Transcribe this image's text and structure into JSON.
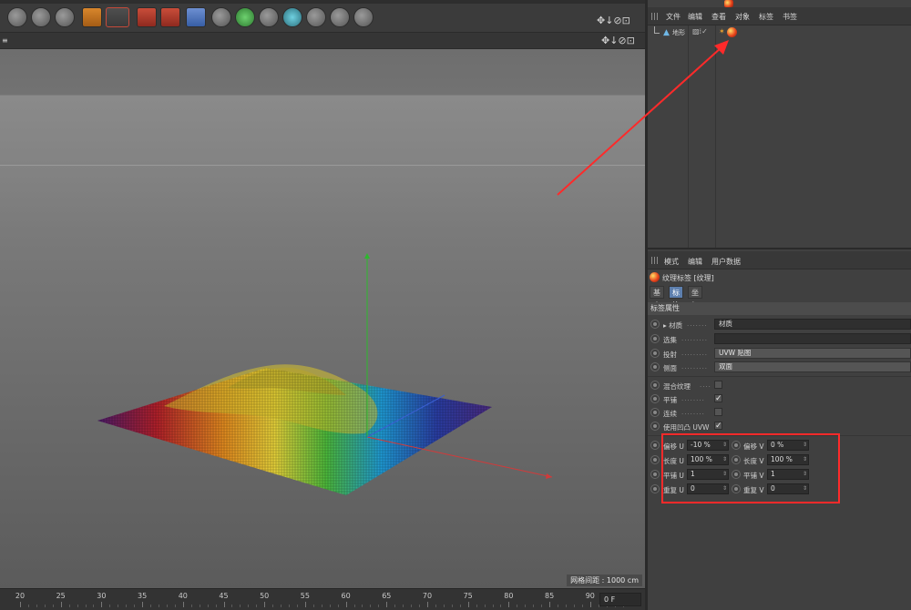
{
  "objects_panel": {
    "menu": [
      "文件",
      "编辑",
      "查看",
      "对象",
      "标签",
      "书签"
    ],
    "object_row": {
      "name": "地形",
      "type_icon": "landscape-icon"
    }
  },
  "attributes_panel": {
    "menu": [
      "模式",
      "编辑",
      "用户数据"
    ],
    "title": "纹理标签 [纹理]",
    "tabs": [
      "基本",
      "标签",
      "坐标"
    ],
    "active_tab": "标签",
    "section": "标签属性",
    "props": {
      "material": {
        "label": "材质",
        "value": "材质"
      },
      "selection": {
        "label": "选集",
        "value": ""
      },
      "projection": {
        "label": "投射",
        "value": "UVW 贴图"
      },
      "side": {
        "label": "侧面",
        "value": "双面"
      },
      "mix": {
        "label": "混合纹理",
        "checked": false
      },
      "tile": {
        "label": "平铺",
        "checked": true
      },
      "seamless": {
        "label": "连续",
        "checked": false
      },
      "use_bump_uvw": {
        "label": "使用凹凸 UVW",
        "checked": true
      }
    },
    "offset": {
      "label_u": "偏移 U",
      "value_u": "-10 %",
      "label_v": "偏移 V",
      "value_v": "0 %"
    },
    "length": {
      "label_u": "长度 U",
      "value_u": "100 %",
      "label_v": "长度 V",
      "value_v": "100 %"
    },
    "tiles": {
      "label_u": "平铺 U",
      "value_u": "1",
      "label_v": "平铺 V",
      "value_v": "1"
    },
    "repeat": {
      "label_u": "重复 U",
      "value_u": "0",
      "label_v": "重复 V",
      "value_v": "0"
    }
  },
  "viewport": {
    "grid_spacing": "网格间距 : 1000 cm"
  },
  "timeline": {
    "ticks": [
      "20",
      "25",
      "30",
      "35",
      "40",
      "45",
      "50",
      "55",
      "60",
      "65",
      "70",
      "75",
      "80",
      "85",
      "90"
    ],
    "current_frame": "0 F"
  },
  "colors": {
    "annotation": "#ff2a2a",
    "active_tab": "#5d7fae"
  }
}
